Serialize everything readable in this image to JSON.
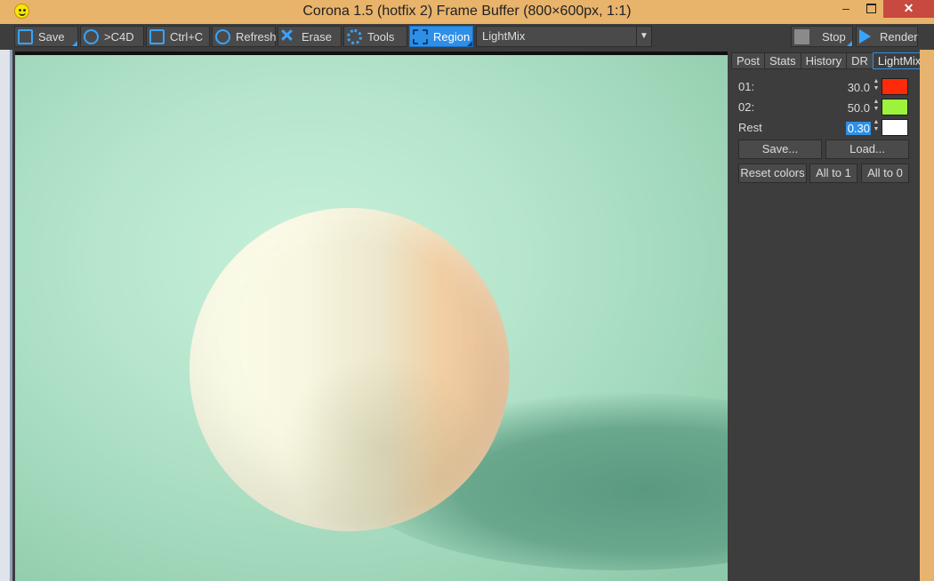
{
  "window": {
    "title": "Corona 1.5 (hotfix 2) Frame Buffer (800×600px, 1:1)",
    "controls": {
      "minimize": "–",
      "close": "✕"
    }
  },
  "toolbar": {
    "save": "Save",
    "to_c4d": ">C4D",
    "copy": "Ctrl+C",
    "refresh": "Refresh",
    "erase": "Erase",
    "tools": "Tools",
    "region": "Region",
    "channel": "LightMix",
    "stop": "Stop",
    "render": "Render"
  },
  "panel": {
    "tabs": [
      "Post",
      "Stats",
      "History",
      "DR",
      "LightMix"
    ],
    "active_tab": "LightMix",
    "lights": [
      {
        "label": "01:",
        "value": "30.0",
        "color": "#ff2a0a"
      },
      {
        "label": "02:",
        "value": "50.0",
        "color": "#9df23c"
      },
      {
        "label": "Rest",
        "value": "0.30",
        "color": "#ffffff"
      }
    ],
    "save_btn": "Save...",
    "load_btn": "Load...",
    "reset_btn": "Reset colors",
    "all1_btn": "All to 1",
    "all0_btn": "All to 0"
  },
  "colors": {
    "accent": "#2e8fe6",
    "titlebar": "#e8b36b",
    "panel_bg": "#3d3d3d"
  }
}
